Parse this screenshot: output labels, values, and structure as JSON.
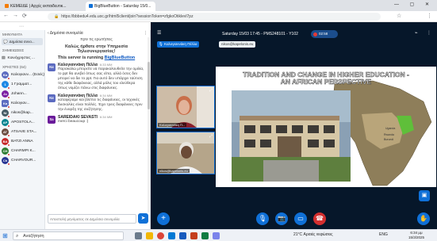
{
  "browser": {
    "tabs": [
      {
        "label": "ΚΕΜΕΙΔΕ | Αρχές εκπαιδευτικ..."
      },
      {
        "label": "BigBlueButton - Saturday 15/0..."
      }
    ],
    "window_controls": "— ▢ ✕",
    "url": "https://bbbedu4.edu.uoc.gr/html5client/join?sessionToken=zfgkoOtiklevl7pz"
  },
  "userlist": {
    "messages_label": "ΜΗΝΥΜΑΤΑ",
    "public_chat_label": "Δημόσια συνο...",
    "notes_label": "ΣΗΜΕΙΩΣΕΙΣ",
    "shared_notes_label": "Κοινόχρηστες ...",
    "users_label": "ΧΡΗΣΤΕΣ (64)",
    "users": [
      {
        "initials": "Κα",
        "name": "Καλογιανν... (Εσείς)",
        "color": "#5c6bc0"
      },
      {
        "initials": "1",
        "name": "1 Γραμματ...",
        "color": "#1e88e5"
      },
      {
        "initials": "Jo",
        "name": "Johann...",
        "color": "#7b1fa2"
      },
      {
        "initials": "Ka",
        "name": "Καλογιαν...",
        "color": "#5c6bc0"
      },
      {
        "initials": "Ni",
        "name": "nikos@kap...",
        "color": "#455a64"
      },
      {
        "initials": "AP",
        "name": "APOSTOLA...",
        "color": "#00838f"
      },
      {
        "initials": "AT",
        "name": "ATSAVE STA...",
        "color": "#6d4c41"
      },
      {
        "initials": "BA",
        "name": "BATZI ANNA",
        "color": "#c62828"
      },
      {
        "initials": "CH",
        "name": "CHARMPI K...",
        "color": "#2e7d32"
      },
      {
        "initials": "Ch",
        "name": "CHARVOUR...",
        "color": "#283593"
      }
    ]
  },
  "chat": {
    "title": "Δημόσια συνομιλία",
    "intro_tail": "πριν τις ερωτήσεις",
    "welcome_line1": "Καλώς ήρθατε στην Υπηρεσία",
    "welcome_line2": "Τηλεσυνεργασίας!",
    "server_text": "This server is running",
    "server_link": "BigBlueButton",
    "messages": [
      {
        "initials": "Κα",
        "color": "#5c6bc0",
        "name": "Καλογιαννάκη Πέλλα",
        "time": "6:33 ΜΜ",
        "text": "Παρακαλώ μπορείτε να παρακολουθείτε την ομιλία, το ppt θα ανεβεί όπως σας είπα, αλλά όσος δεν μπορεί να δει το ppt. Για αυτό δεν υπάρχει ταύτιση της κάθε διαφάνειας, αλλά μόλις του ελεύθερα όπως νομίζει πάνω στις διαφάνειες."
      },
      {
        "initials": "Κα",
        "color": "#5c6bc0",
        "name": "Καλογιαννάκη Πέλλα",
        "time": "6:34 ΜΜ",
        "text": "καταφέραμε και βλέπει τις διαφάνειες, οι τεχνικές δυσκολίες είναι πολλές. Έχει τρεις διαφάνειες πριν την έναρξη της συζήτησης."
      },
      {
        "initials": "Sa",
        "color": "#6a1b9a",
        "name": "SAREIDAKI SEVASTI",
        "time": "6:34 ΜΜ",
        "text": "merci beaucoup :)"
      }
    ],
    "input_placeholder": "Αποστολή μηνύματος σε Δημόσια συνομιλία"
  },
  "stage": {
    "meeting_title": "Saturday 15/03 17:45 - PMS248101 - Υ102",
    "recording_time": "02:58",
    "speaker_name": "Καλογιαννάκη Πέλλα",
    "speaker_email": "nikos@kapelonis.eu",
    "cams": [
      {
        "label": "Καλογιαννάκη Π..."
      },
      {
        "label": "nikos@kapelonis.eu"
      }
    ],
    "slide_title": "TRADITION AND CHANGE IN HIGHER EDUCATION - AN AFRICAN PERSPECTIVE",
    "slide_map_labels": [
      "Uganda",
      "Rwanda",
      "Burundi"
    ]
  },
  "taskbar": {
    "search_label": "Αναζήτηση",
    "weather": "21°C  Αραιές νεφώσεις",
    "tray": "ENG",
    "time": "6:34 μμ",
    "date": "15/3/2025"
  }
}
